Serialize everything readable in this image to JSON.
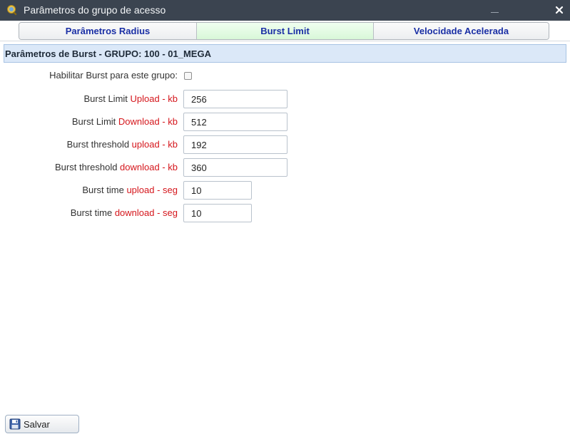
{
  "window": {
    "title": "Parâmetros do grupo de acesso",
    "app_icon": "magnifier-globe-icon",
    "minimize_icon": "minimize-icon",
    "close_icon": "close-icon",
    "titlebar_color": "#3b4450"
  },
  "tabs": [
    {
      "label": "Parâmetros Radius",
      "active": false
    },
    {
      "label": "Burst Limit",
      "active": true
    },
    {
      "label": "Velocidade Acelerada",
      "active": false
    }
  ],
  "section": {
    "title": "Parâmetros de Burst - GRUPO: 100 - 01_MEGA",
    "background": "#dbe8f8"
  },
  "form": {
    "enable_burst": {
      "label": "Habilitar Burst para este grupo:",
      "checked": false
    },
    "fields": [
      {
        "label_prefix": "Burst Limit ",
        "label_highlight": "Upload - kb",
        "value": "256"
      },
      {
        "label_prefix": "Burst Limit ",
        "label_highlight": "Download - kb",
        "value": "512"
      },
      {
        "label_prefix": "Burst threshold ",
        "label_highlight": "upload - kb",
        "value": "192"
      },
      {
        "label_prefix": "Burst threshold ",
        "label_highlight": "download - kb",
        "value": "360"
      },
      {
        "label_prefix": "Burst time ",
        "label_highlight": "upload - seg",
        "value": "10"
      },
      {
        "label_prefix": "Burst time ",
        "label_highlight": "download - seg",
        "value": "10"
      }
    ],
    "highlight_color": "#d5161c"
  },
  "footer": {
    "save_label": "Salvar",
    "save_icon": "floppy-disk-icon"
  }
}
